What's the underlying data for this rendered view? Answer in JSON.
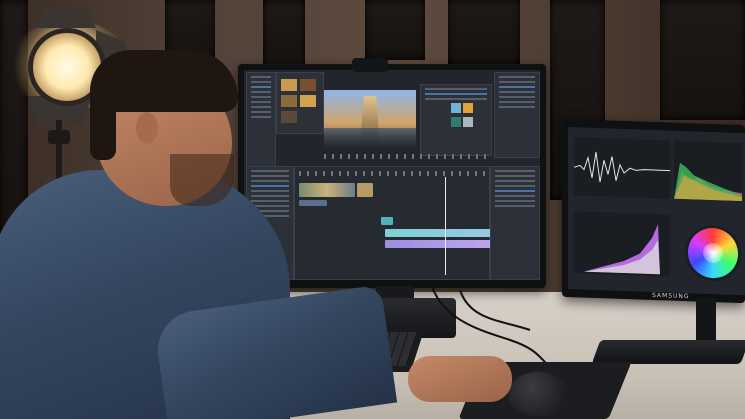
{
  "scene": {
    "description_free": true
  },
  "monitors": {
    "right_brand": "SAMSUNG",
    "left_brand": ""
  },
  "colors": {
    "wall": "#54433a",
    "shirt": "#34465f",
    "screen_bg": "#22262c",
    "accent_blue": "#5d8fd6",
    "waveform": "#e6e6e6"
  },
  "icons": {
    "studio_light": "studio-light",
    "webcam": "webcam",
    "color_wheel": "color-wheel",
    "mouse": "mouse",
    "keyboard": "keyboard"
  }
}
